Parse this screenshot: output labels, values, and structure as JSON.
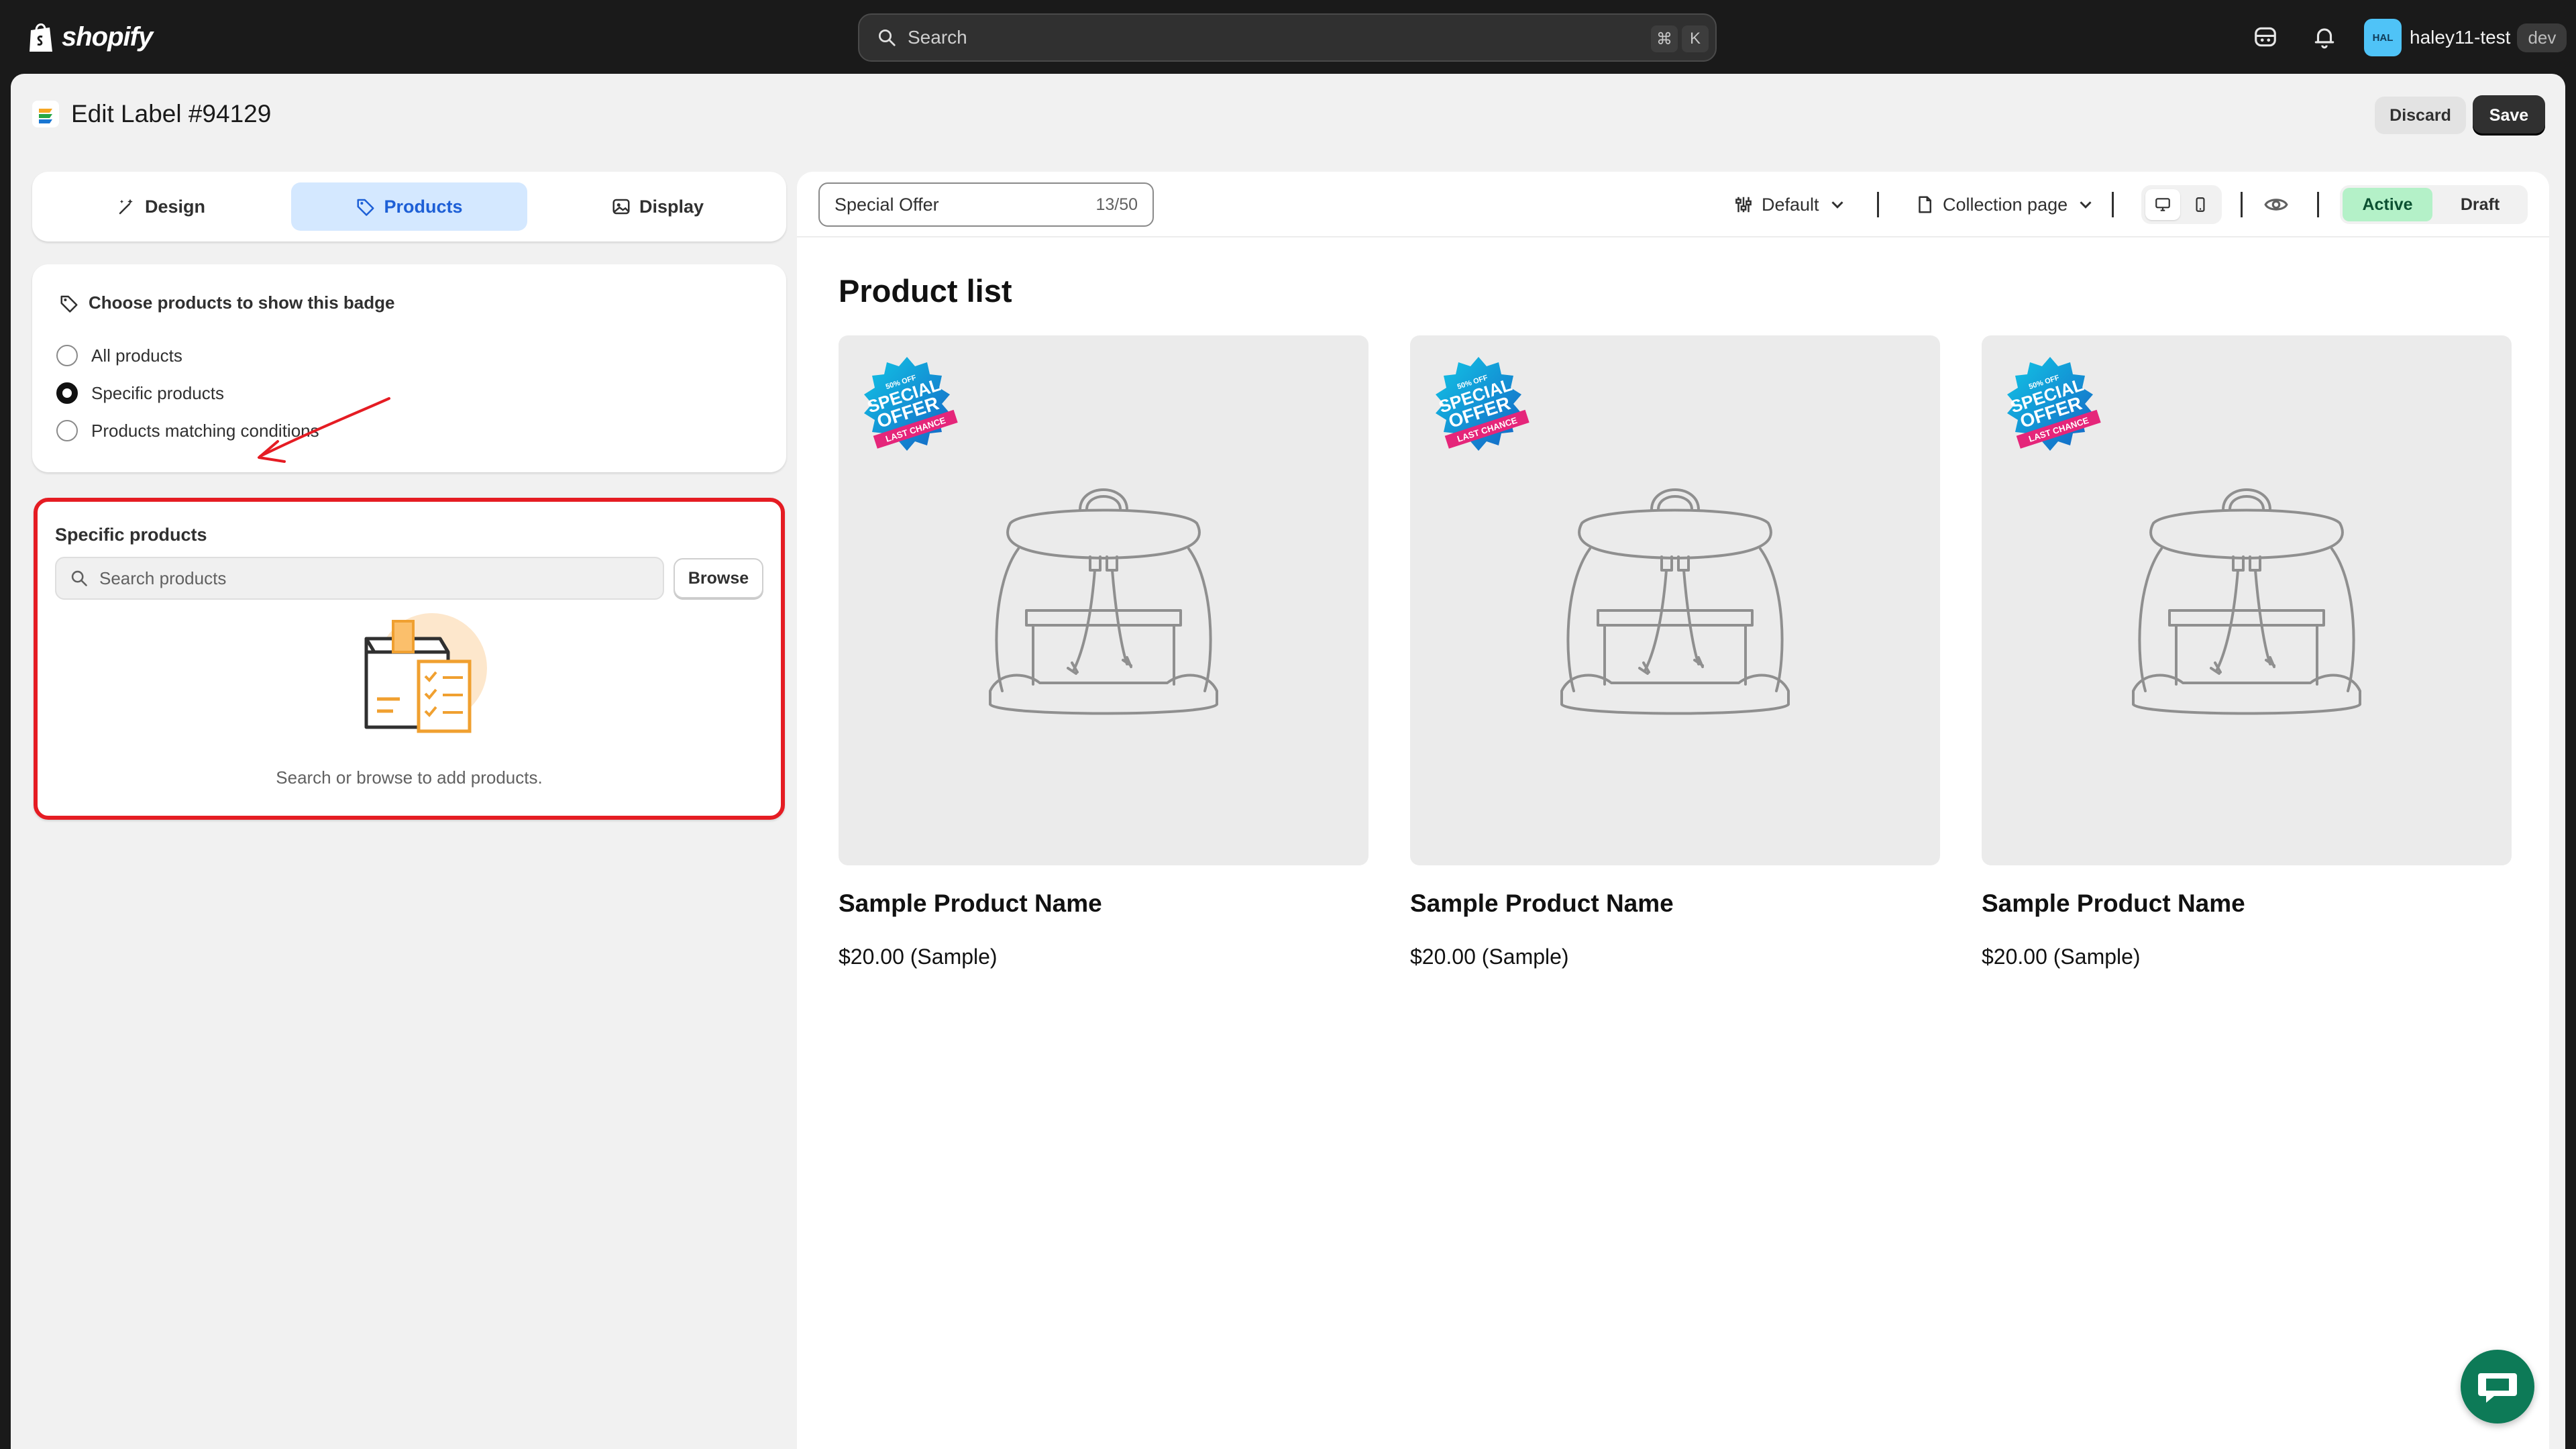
{
  "topbar": {
    "logo_text": "shopify",
    "search_placeholder": "Search",
    "shortcut_cmd": "⌘",
    "shortcut_key": "K",
    "avatar_initials": "HAL",
    "username": "haley11-test",
    "store_badge": "dev"
  },
  "page": {
    "title": "Edit Label #94129",
    "discard_label": "Discard",
    "save_label": "Save"
  },
  "tabs": [
    {
      "label": "Design",
      "icon": "magic-wand-icon"
    },
    {
      "label": "Products",
      "icon": "tag-icon",
      "active": true
    },
    {
      "label": "Display",
      "icon": "image-icon"
    }
  ],
  "choose": {
    "heading": "Choose products to show this badge",
    "options": [
      {
        "label": "All products",
        "checked": false
      },
      {
        "label": "Specific products",
        "checked": true
      },
      {
        "label": "Products matching conditions",
        "checked": false
      }
    ]
  },
  "specific": {
    "title": "Specific products",
    "search_placeholder": "Search products",
    "browse_label": "Browse",
    "empty_text": "Search or browse to add products."
  },
  "preview": {
    "label_name": "Special Offer",
    "label_count": "13/50",
    "template": "Default",
    "page_type": "Collection page",
    "status_active": "Active",
    "status_draft": "Draft",
    "list_title": "Product list",
    "products": [
      {
        "name": "Sample Product Name",
        "price": "$20.00 (Sample)"
      },
      {
        "name": "Sample Product Name",
        "price": "$20.00 (Sample)"
      },
      {
        "name": "Sample Product Name",
        "price": "$20.00 (Sample)"
      }
    ],
    "badge": {
      "top": "50% OFF",
      "line1": "SPECIAL",
      "line2": "OFFER",
      "ribbon": "LAST CHANCE"
    }
  },
  "colors": {
    "highlight_border": "#e51c23",
    "active_tab_bg": "#d4e8ff",
    "active_status_bg": "#b4f1c8",
    "chat_bg": "#0d7a57"
  }
}
